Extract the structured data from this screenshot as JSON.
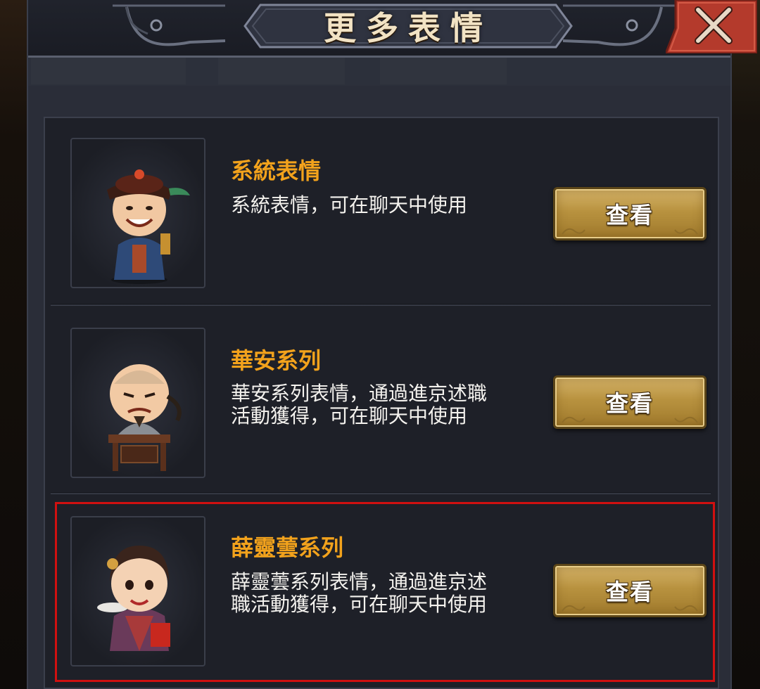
{
  "dialog": {
    "title": "更多表情",
    "close_icon": "close-x-icon"
  },
  "colors": {
    "panel_bg": "#2a2d38",
    "list_bg": "#1e2028",
    "item_title": "#f2a21c",
    "item_desc": "#f4f2ee",
    "button_gold": "#c4a052",
    "close_red": "#b43a2c",
    "highlight_red": "#d01010"
  },
  "items": [
    {
      "title": "系統表情",
      "desc": "系統表情，可在聊天中使用",
      "button": "查看",
      "portrait_icon": "official-character-portrait"
    },
    {
      "title": "華安系列",
      "desc": "華安系列表情，通過進京述職\n活動獲得，可在聊天中使用",
      "button": "查看",
      "portrait_icon": "hua-an-character-portrait"
    },
    {
      "title": "薛靈蕓系列",
      "desc": "薛靈蕓系列表情，通過進京述\n職活動獲得，可在聊天中使用",
      "button": "查看",
      "portrait_icon": "xue-lingyun-character-portrait",
      "highlighted": true
    }
  ]
}
